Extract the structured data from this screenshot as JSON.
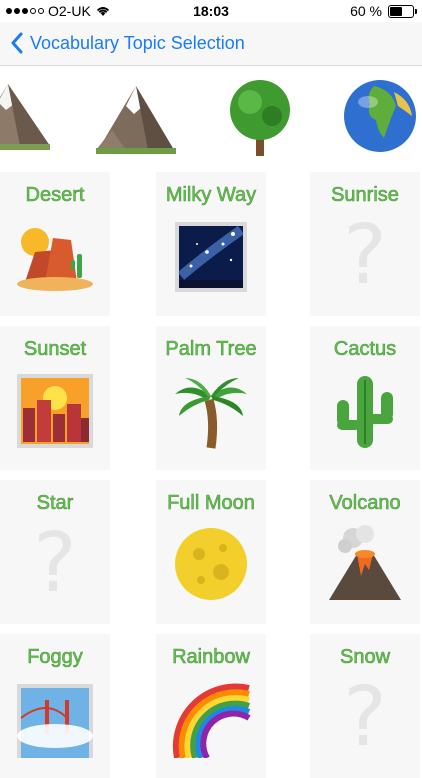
{
  "status_bar": {
    "carrier": "O2-UK",
    "time": "18:03",
    "battery_percent": "60 %",
    "battery_level": 0.6
  },
  "nav": {
    "back_title": "Vocabulary Topic Selection"
  },
  "strip": [
    {
      "icon": "mountain-icon"
    },
    {
      "icon": "snow-mountain-icon"
    },
    {
      "icon": "deciduous-tree-icon"
    },
    {
      "icon": "globe-africa-icon"
    }
  ],
  "cards": [
    {
      "label": "Desert",
      "icon": "desert-icon"
    },
    {
      "label": "Milky Way",
      "icon": "milky-way-icon"
    },
    {
      "label": "Sunrise",
      "icon": "question-mark-icon"
    },
    {
      "label": "Sunset",
      "icon": "sunset-city-icon"
    },
    {
      "label": "Palm Tree",
      "icon": "palm-tree-icon"
    },
    {
      "label": "Cactus",
      "icon": "cactus-icon"
    },
    {
      "label": "Star",
      "icon": "question-mark-icon"
    },
    {
      "label": "Full Moon",
      "icon": "full-moon-icon"
    },
    {
      "label": "Volcano",
      "icon": "volcano-icon"
    },
    {
      "label": "Foggy",
      "icon": "foggy-bridge-icon"
    },
    {
      "label": "Rainbow",
      "icon": "rainbow-icon"
    },
    {
      "label": "Snow",
      "icon": "question-mark-icon"
    }
  ],
  "colors": {
    "accent": "#1a7cf5",
    "label_green": "#67c152",
    "card_bg": "#f7f7f7"
  }
}
